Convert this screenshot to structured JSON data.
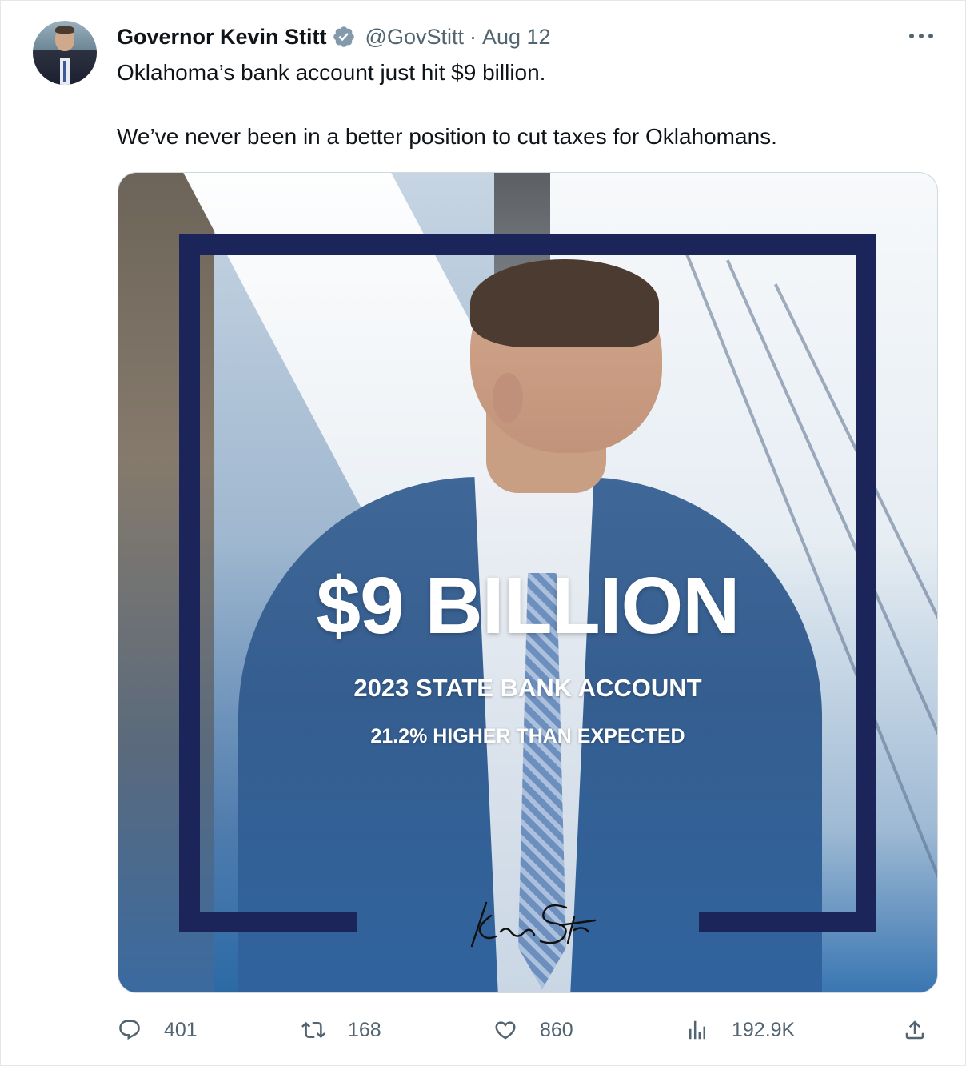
{
  "author": {
    "display_name": "Governor Kevin Stitt",
    "handle": "@GovStitt",
    "separator": "·",
    "date": "Aug 12",
    "verified_icon": "verified-badge-icon"
  },
  "tweet": {
    "text_line_1": "Oklahoma’s bank account just hit $9 billion.",
    "text_line_2": "We’ve never been in a better position to cut taxes for Oklahomans."
  },
  "media": {
    "headline": "$9 BILLION",
    "subheading": "2023 STATE BANK ACCOUNT",
    "detail": "21.2% HIGHER THAN EXPECTED",
    "signature_text": "Kevin Stitt",
    "frame_color": "#1b2559"
  },
  "actions": {
    "replies": "401",
    "retweets": "168",
    "likes": "860",
    "views": "192.9K"
  },
  "colors": {
    "text_primary": "#0f1419",
    "text_secondary": "#536471",
    "verified": "#829aab"
  }
}
